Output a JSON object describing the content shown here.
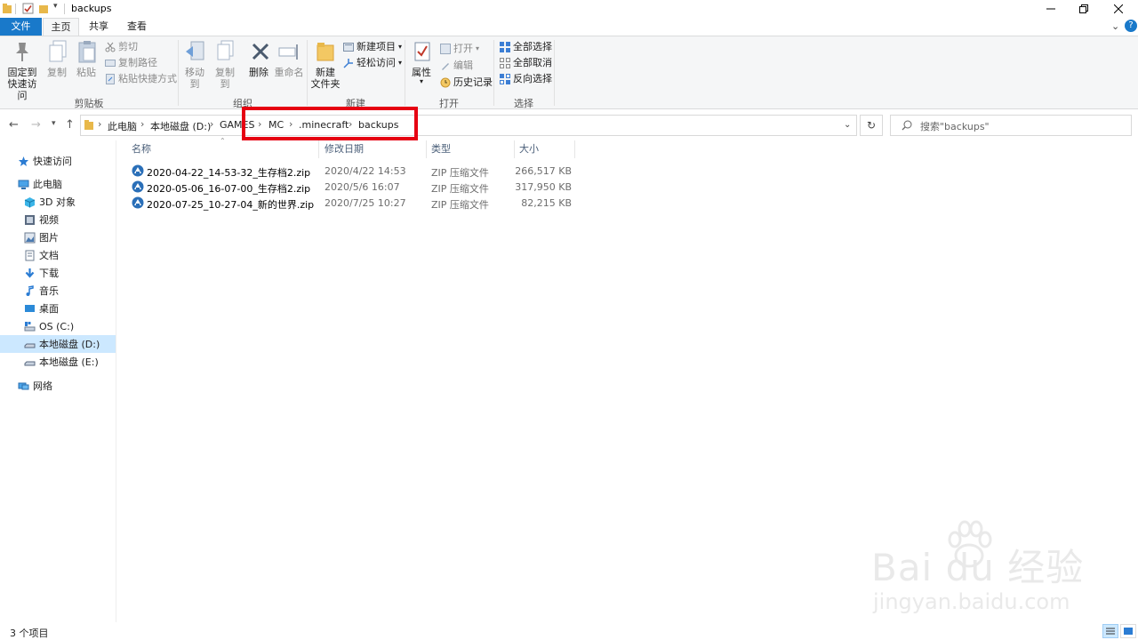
{
  "window": {
    "title": "backups",
    "controls": [
      "minimize",
      "restore",
      "close"
    ]
  },
  "ribbon_tabs": [
    {
      "label": "文件"
    },
    {
      "label": "主页"
    },
    {
      "label": "共享"
    },
    {
      "label": "查看"
    }
  ],
  "ribbon": {
    "clipboard": {
      "group_label": "剪贴板",
      "pin_label_1": "固定到",
      "pin_label_2": "快速访问",
      "copy_label": "复制",
      "paste_label": "粘贴",
      "cut_label": "剪切",
      "copy_path_label": "复制路径",
      "paste_shortcut_label": "粘贴快捷方式"
    },
    "organize": {
      "group_label": "组织",
      "move_to_label": "移动到",
      "copy_to_label": "复制到",
      "delete_label": "删除",
      "rename_label": "重命名"
    },
    "new": {
      "group_label": "新建",
      "new_folder_label_1": "新建",
      "new_folder_label_2": "文件夹",
      "new_item_label": "新建项目",
      "easy_access_label": "轻松访问"
    },
    "open": {
      "group_label": "打开",
      "properties_label": "属性",
      "open_label": "打开",
      "edit_label": "编辑",
      "history_label": "历史记录"
    },
    "select": {
      "group_label": "选择",
      "select_all_label": "全部选择",
      "select_none_label": "全部取消",
      "invert_label": "反向选择"
    }
  },
  "address": {
    "crumbs": [
      "此电脑",
      "本地磁盘 (D:)",
      "GAMES",
      "MC",
      ".minecraft",
      "backups"
    ],
    "search_placeholder": "搜索\"backups\""
  },
  "nav": {
    "quick_access": "快速访问",
    "this_pc": "此电脑",
    "items": [
      {
        "label": "3D 对象",
        "icon": "3d-objects-icon"
      },
      {
        "label": "视频",
        "icon": "videos-icon"
      },
      {
        "label": "图片",
        "icon": "pictures-icon"
      },
      {
        "label": "文档",
        "icon": "documents-icon"
      },
      {
        "label": "下载",
        "icon": "downloads-icon"
      },
      {
        "label": "音乐",
        "icon": "music-icon"
      },
      {
        "label": "桌面",
        "icon": "desktop-icon"
      },
      {
        "label": "OS (C:)",
        "icon": "drive-c-icon"
      },
      {
        "label": "本地磁盘 (D:)",
        "icon": "drive-icon",
        "selected": true
      },
      {
        "label": "本地磁盘 (E:)",
        "icon": "drive-icon"
      }
    ],
    "network": "网络"
  },
  "files": {
    "columns": {
      "name": "名称",
      "date": "修改日期",
      "type": "类型",
      "size": "大小"
    },
    "rows": [
      {
        "name": "2020-04-22_14-53-32_生存档2.zip",
        "date": "2020/4/22 14:53",
        "type": "ZIP 压缩文件",
        "size": "266,517 KB"
      },
      {
        "name": "2020-05-06_16-07-00_生存档2.zip",
        "date": "2020/5/6 16:07",
        "type": "ZIP 压缩文件",
        "size": "317,950 KB"
      },
      {
        "name": "2020-07-25_10-27-04_新的世界.zip",
        "date": "2020/7/25 10:27",
        "type": "ZIP 压缩文件",
        "size": "82,215 KB"
      }
    ]
  },
  "status": {
    "item_count": "3 个项目"
  },
  "watermark": {
    "brand": "Bai du 经验",
    "url": "jingyan.baidu.com"
  },
  "colors": {
    "file_tab": "#1979ca",
    "selection": "#cce8ff",
    "highlight_box": "#e60012",
    "folder": "#e8b84a"
  }
}
